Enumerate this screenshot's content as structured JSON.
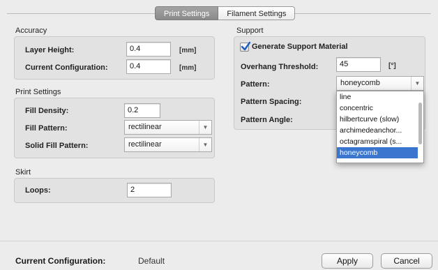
{
  "tabs": [
    {
      "label": "Print Settings",
      "active": true
    },
    {
      "label": "Filament Settings",
      "active": false
    }
  ],
  "accuracy": {
    "title": "Accuracy",
    "layer_height": {
      "label": "Layer Height:",
      "value": "0.4",
      "unit": "[mm]"
    },
    "current_configuration": {
      "label": "Current Configuration:",
      "value": "0.4",
      "unit": "[mm]"
    }
  },
  "print_settings": {
    "title": "Print Settings",
    "fill_density": {
      "label": "Fill Density:",
      "value": "0.2"
    },
    "fill_pattern": {
      "label": "Fill Pattern:",
      "value": "rectilinear"
    },
    "solid_fill_pattern": {
      "label": "Solid Fill Pattern:",
      "value": "rectilinear"
    }
  },
  "skirt": {
    "title": "Skirt",
    "loops": {
      "label": "Loops:",
      "value": "2"
    }
  },
  "support": {
    "title": "Support",
    "generate": {
      "label": "Generate Support Material",
      "checked": true
    },
    "overhang": {
      "label": "Overhang Threshold:",
      "value": "45",
      "unit": "[°]"
    },
    "pattern": {
      "label": "Pattern:",
      "value": "honeycomb"
    },
    "spacing": {
      "label": "Pattern Spacing:"
    },
    "angle": {
      "label": "Pattern Angle:"
    },
    "options": [
      "line",
      "concentric",
      "hilbertcurve (slow)",
      "archimedeanchor...",
      "octagramspiral (s...",
      "honeycomb"
    ],
    "selected_option": "honeycomb"
  },
  "footer": {
    "config_label": "Current Configuration:",
    "config_value": "Default",
    "apply_label": "Apply",
    "cancel_label": "Cancel"
  },
  "colors": {
    "accent": "#3a76d0",
    "tab_active": "#8f8f8f"
  }
}
